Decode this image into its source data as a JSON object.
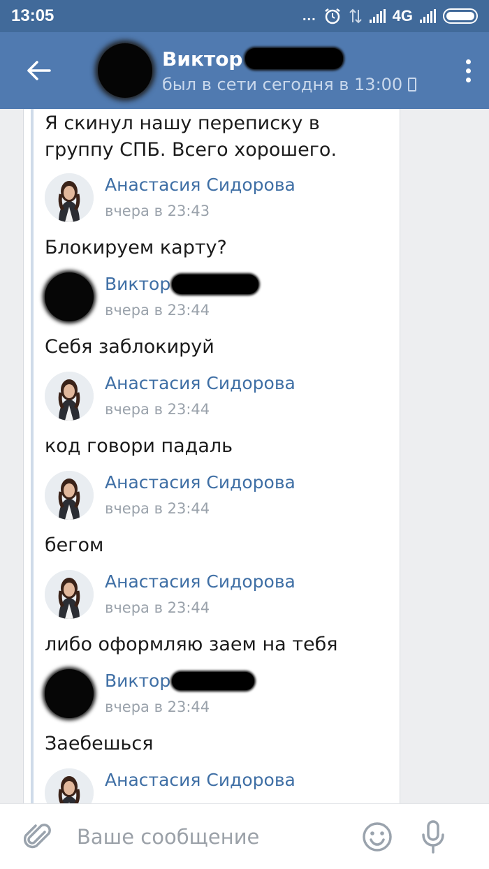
{
  "status_bar": {
    "time": "13:05",
    "network": "4G",
    "dots": "...",
    "icons": [
      "alarm-icon",
      "data-arrows-icon",
      "signal-icon",
      "signal-icon",
      "battery-icon"
    ]
  },
  "header": {
    "name": "Виктор",
    "status": "был в сети сегодня в 13:00",
    "icons": [
      "back-arrow-icon",
      "phone-device-icon",
      "more-vertical-icon"
    ]
  },
  "conversation": {
    "first_text": "Я скинул нашу переписку в группу СПБ. Всего хорошего.",
    "messages": [
      {
        "author": "Анастасия Сидорова",
        "time": "вчера в 23:43",
        "text": "Блокируем карту?"
      },
      {
        "author": "Виктор",
        "time": "вчера в 23:44",
        "text": "Себя заблокируй"
      },
      {
        "author": "Анастасия Сидорова",
        "time": "вчера в 23:44",
        "text": "код говори падаль"
      },
      {
        "author": "Анастасия Сидорова",
        "time": "вчера в 23:44",
        "text": "бегом"
      },
      {
        "author": "Анастасия Сидорова",
        "time": "вчера в 23:44",
        "text": "либо оформляю заем на тебя"
      },
      {
        "author": "Виктор",
        "time": "вчера в 23:44",
        "text": "Заебешься"
      },
      {
        "author": "Анастасия Сидорова",
        "time": "",
        "text": ""
      }
    ]
  },
  "composer": {
    "placeholder": "Ваше сообщение",
    "icons": [
      "paperclip-icon",
      "emoji-icon",
      "microphone-icon"
    ]
  },
  "colors": {
    "header": "#507ab0",
    "status_bar": "#416a9a",
    "link": "#3f6fa5",
    "background": "#edeef0"
  }
}
